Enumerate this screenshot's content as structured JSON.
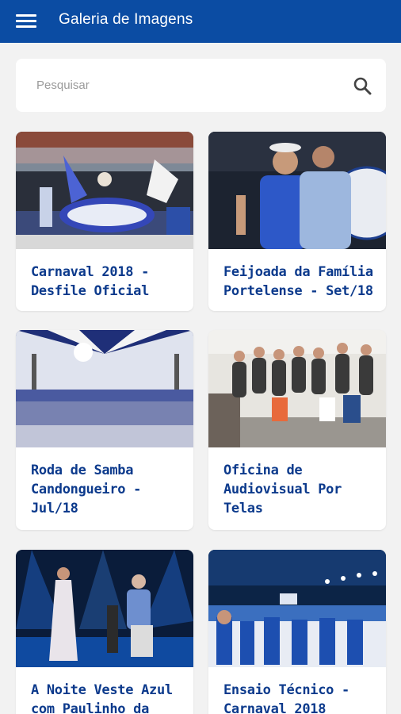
{
  "appbar": {
    "title": "Galeria de Imagens",
    "menu_icon": "menu-icon"
  },
  "search": {
    "placeholder": "Pesquisar",
    "icon": "search-icon"
  },
  "gallery": [
    {
      "title": "Carnaval 2018 - Desfile Oficial"
    },
    {
      "title": "Feijoada da Família Portelense - Set/18"
    },
    {
      "title": "Roda de Samba Candongueiro - Jul/18"
    },
    {
      "title": "Oficina de Audiovisual Por Telas"
    },
    {
      "title": "A Noite Veste Azul com Paulinho da"
    },
    {
      "title": "Ensaio Técnico - Carnaval 2018"
    }
  ],
  "colors": {
    "appbar": "#0b4ca3",
    "title_text": "#0c3a8c",
    "background": "#f2f2f2"
  }
}
